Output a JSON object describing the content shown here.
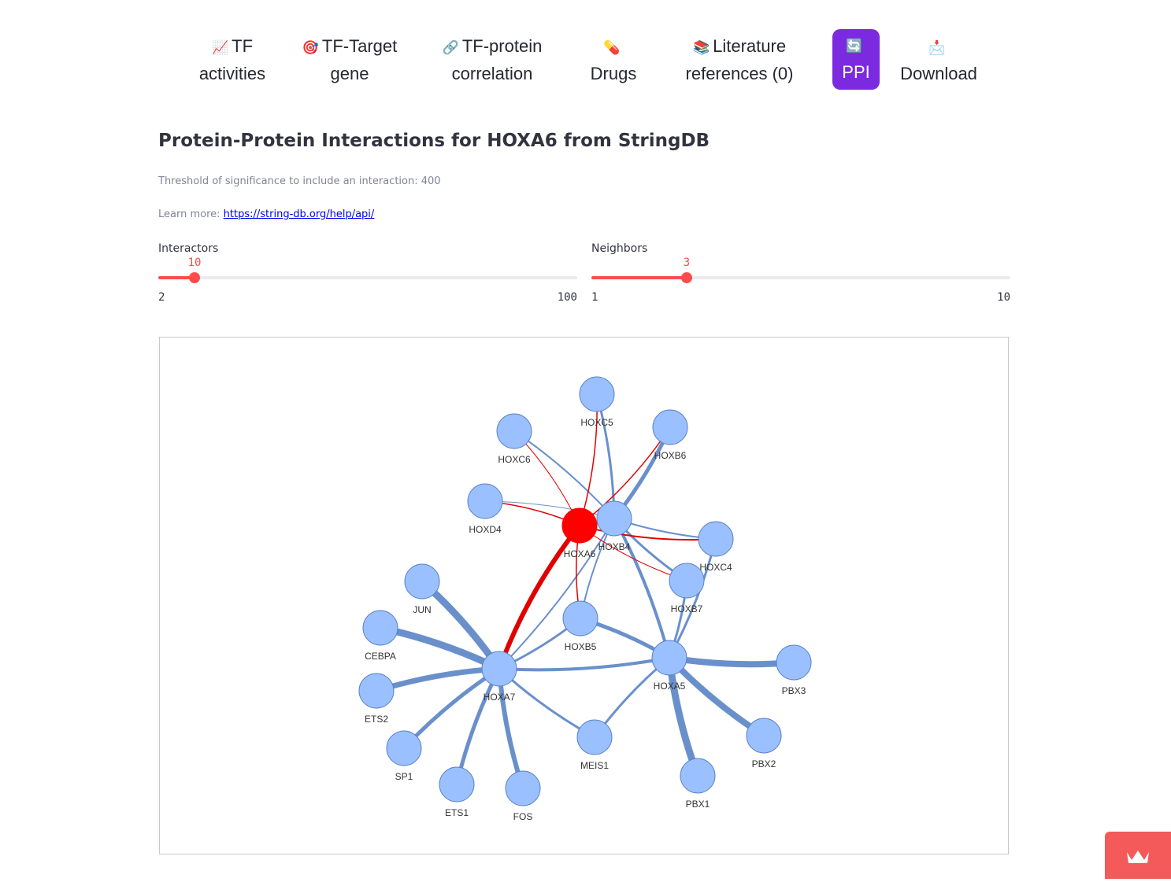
{
  "tabs": [
    {
      "emoji": "📈",
      "line1": "TF",
      "line2": "activities",
      "active": false
    },
    {
      "emoji": "🎯",
      "line1": "TF-Target",
      "line2": "gene",
      "active": false
    },
    {
      "emoji": "🔗",
      "line1": "TF-protein",
      "line2": "correlation",
      "active": false
    },
    {
      "emoji": "💊",
      "line1": "",
      "line2": "Drugs",
      "active": false
    },
    {
      "emoji": "📚",
      "line1": "Literature",
      "line2": "references (0)",
      "active": false
    },
    {
      "emoji": "🔄",
      "line1": "",
      "line2": "PPI",
      "active": true
    },
    {
      "emoji": "📩",
      "line1": "",
      "line2": "Download",
      "active": false
    }
  ],
  "page": {
    "title": "Protein-Protein Interactions for HOXA6 from StringDB",
    "threshold_text": "Threshold of significance to include an interaction: 400",
    "learn_more_label": "Learn more: ",
    "learn_more_link": "https://string-db.org/help/api/"
  },
  "sliders": {
    "interactors": {
      "label": "Interactors",
      "value": "10",
      "min": "2",
      "max": "100",
      "value_num": 10,
      "min_num": 2,
      "max_num": 100
    },
    "neighbors": {
      "label": "Neighbors",
      "value": "3",
      "min": "1",
      "max": "10",
      "value_num": 3,
      "min_num": 1,
      "max_num": 10
    }
  },
  "network": {
    "nodes": [
      "HOXC5",
      "HOXC6",
      "HOXB6",
      "HOXD4",
      "HOXA6",
      "HOXB4",
      "HOXC4",
      "HOXB7",
      "JUN",
      "HOXB5",
      "CEBPA",
      "HOXA7",
      "HOXA5",
      "PBX3",
      "ETS2",
      "SP1",
      "MEIS1",
      "PBX2",
      "ETS1",
      "FOS",
      "PBX1"
    ],
    "focus_node": "HOXA6",
    "colors": {
      "node": "#9ac0ff",
      "focus": "#ff0000",
      "edge": "#6a90cc",
      "focus_edge": "#e00000"
    }
  }
}
